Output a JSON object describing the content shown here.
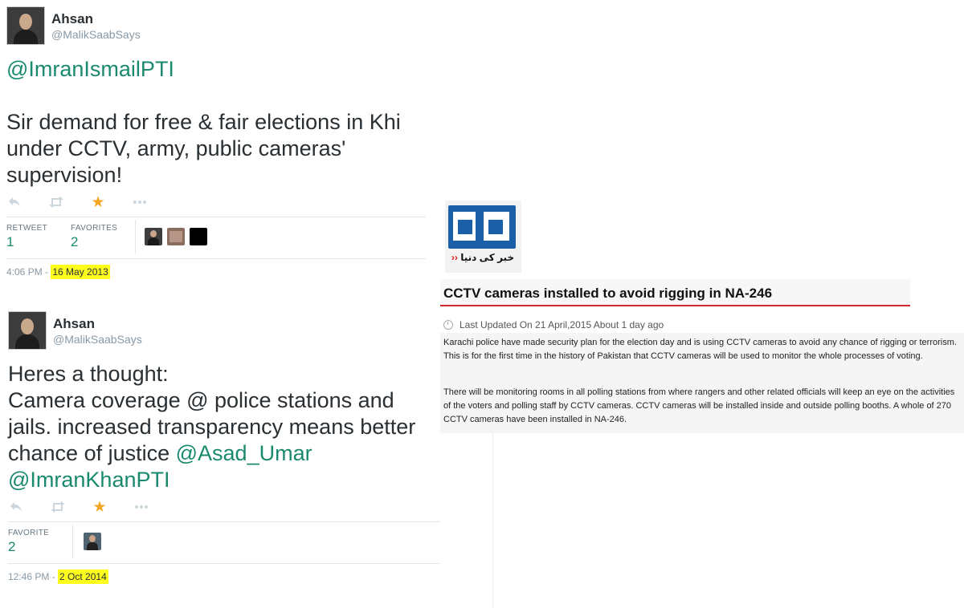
{
  "tweets": [
    {
      "author_name": "Ahsan",
      "handle": "@MalikSaabSays",
      "text_mention": "@ImranIsmailPTI",
      "text_body": "Sir demand for free & fair elections in Khi under CCTV, army, public cameras' supervision!",
      "actions": [
        "reply-icon",
        "retweet-icon",
        "favorite-star-icon",
        "more-icon"
      ],
      "stats": [
        {
          "label": "RETWEET",
          "value": "1"
        },
        {
          "label": "FAVORITES",
          "value": "2"
        }
      ],
      "time": "4:06 PM - ",
      "date": "16 May 2013"
    },
    {
      "author_name": "Ahsan",
      "handle": "@MalikSaabSays",
      "text_line1": "Heres a thought:",
      "text_line2": "Camera coverage @ police stations and jails. increased transparency means better chance of justice ",
      "mention1": "@Asad_Umar",
      "mention2": "@ImranKhanPTI",
      "actions": [
        "reply-icon",
        "retweet-icon",
        "favorite-star-icon",
        "more-icon"
      ],
      "stats": [
        {
          "label": "FAVORITE",
          "value": "2"
        }
      ],
      "time": "12:46 PM - ",
      "date": "2 Oct 2014"
    }
  ],
  "news": {
    "logo_urdu": "خبر کی دنیا",
    "headline": "CCTV cameras installed to avoid rigging in NA-246",
    "updated": "Last Updated On 21 April,2015 About 1 day ago",
    "paragraphs": [
      "Karachi police have made security plan for the election day and is using CCTV cameras to avoid any chance of rigging or terrorism. This is for the first time in the history of Pakistan that CCTV cameras will be used to monitor the whole processes of voting.",
      "There will be monitoring rooms in all polling stations from where rangers and other related officials will keep an eye on the activities of the voters and polling staff by CCTV cameras. CCTV cameras will be installed inside and outside polling booths. A whole of 270 CCTV cameras have been installed in NA-246."
    ]
  },
  "colors": {
    "mention": "#1a8a6e",
    "highlight": "#ffff1e",
    "headline_underline": "#d4242c",
    "logo_blue": "#1a5fa8"
  }
}
